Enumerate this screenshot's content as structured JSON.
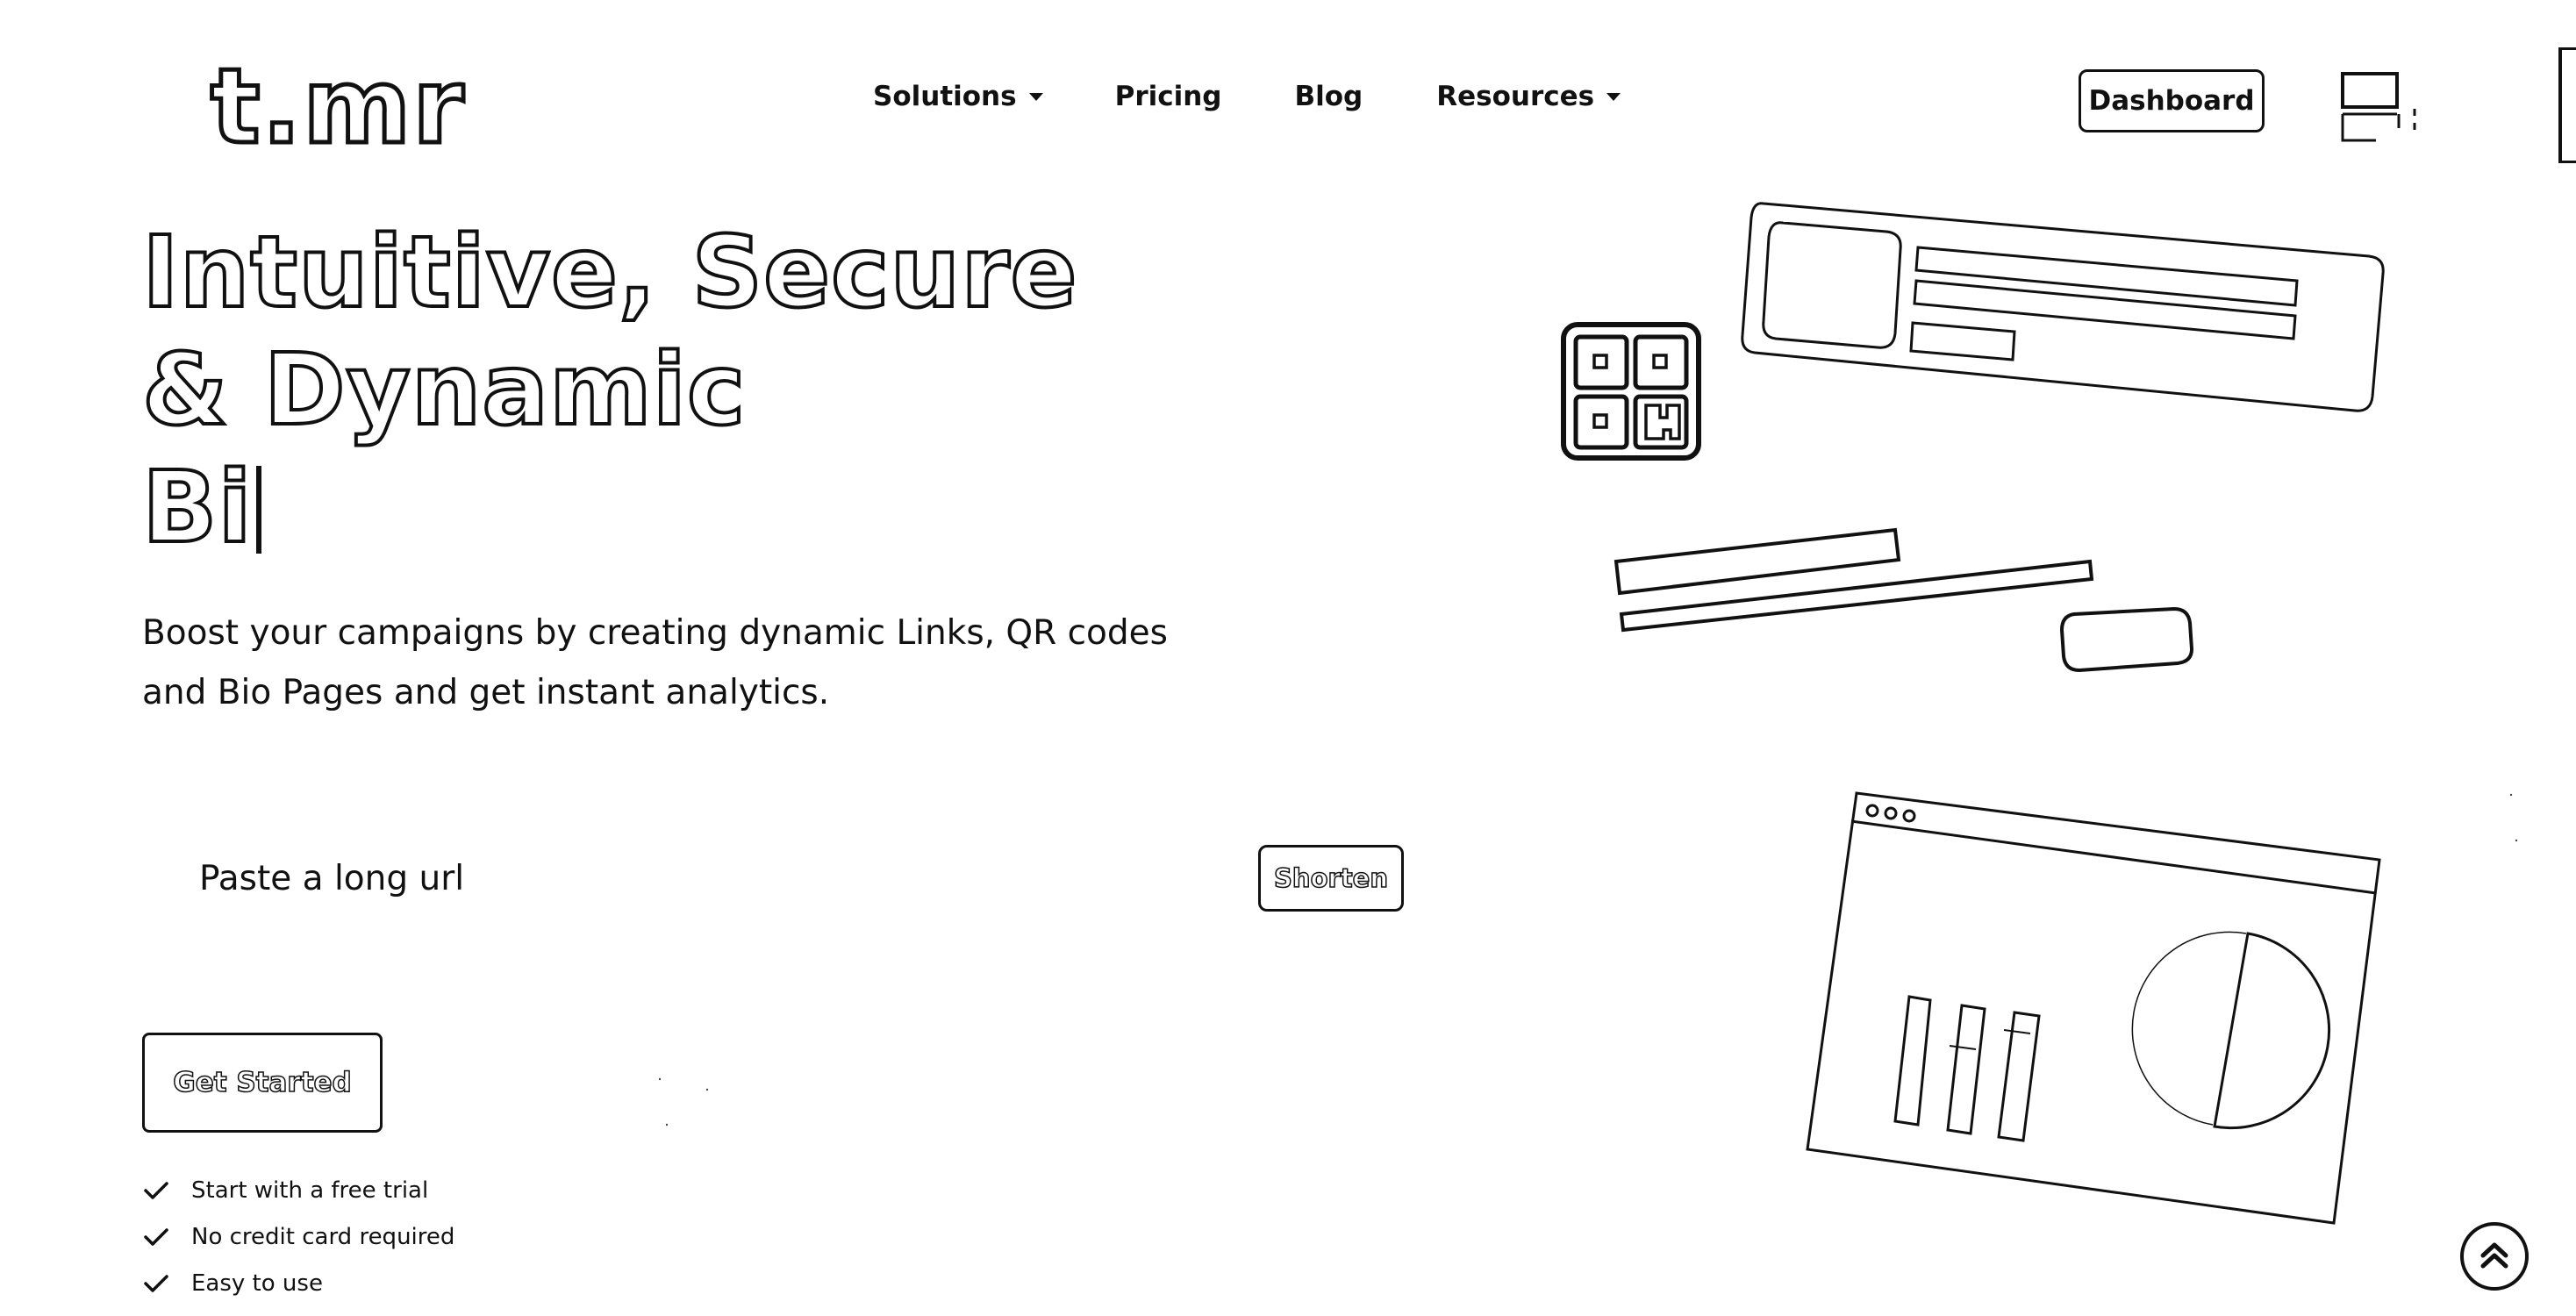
{
  "header": {
    "logo_text": "t.mr",
    "nav": {
      "solutions": "Solutions",
      "pricing": "Pricing",
      "blog": "Blog",
      "resources": "Resources"
    },
    "dashboard_label": "Dashboard"
  },
  "hero": {
    "title_line1": "Intuitive, Secure",
    "title_line2": "& Dynamic",
    "title_line3": "Bi",
    "subtitle": "Boost your campaigns by creating dynamic Links, QR codes and Bio Pages and get instant analytics."
  },
  "shorten_form": {
    "placeholder": "Paste a long url",
    "button_label": "Shorten"
  },
  "cta": {
    "get_started_label": "Get Started"
  },
  "features": [
    {
      "text": "Start with a free trial",
      "icon": "check-icon"
    },
    {
      "text": "No credit card required",
      "icon": "check-icon"
    },
    {
      "text": "Easy to use",
      "icon": "check-icon"
    }
  ],
  "icons": {
    "dropdown": "caret-down-icon",
    "scroll_top": "chevron-up-circle-icon",
    "qr": "qr-code-icon"
  },
  "colors": {
    "ink": "#111111",
    "background": "#ffffff"
  }
}
